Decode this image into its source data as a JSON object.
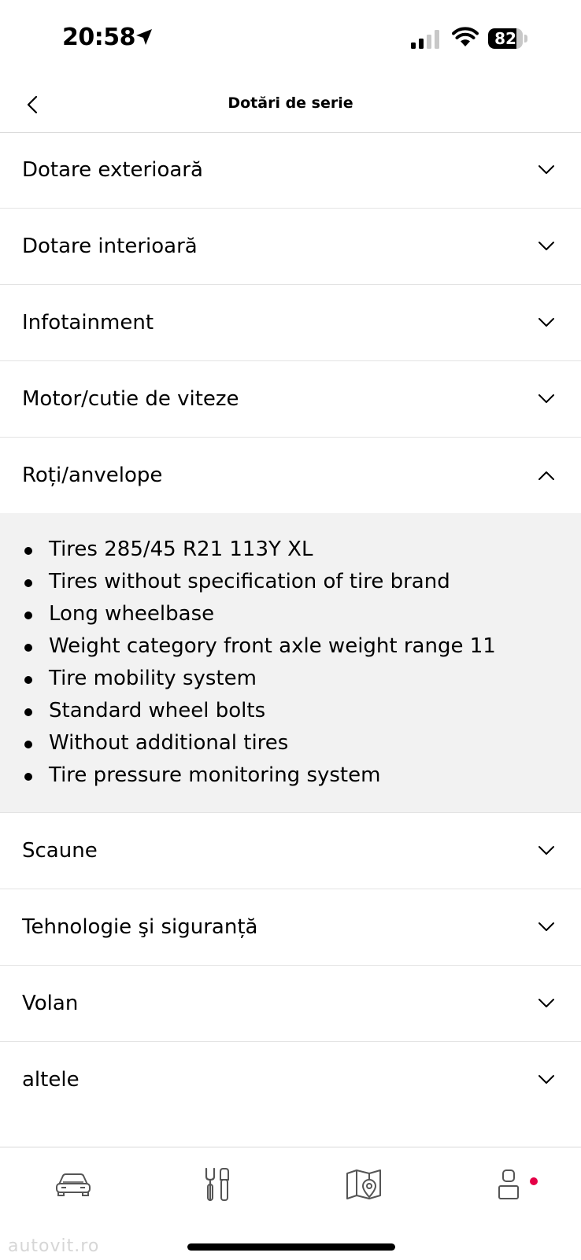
{
  "status_bar": {
    "time": "20:58",
    "battery_level": "82",
    "battery_fraction": 0.82
  },
  "header": {
    "title": "Dotări de serie",
    "back_icon": "chevron-left-icon"
  },
  "accordion": {
    "sections": [
      {
        "label": "Dotare exterioară",
        "expanded": false
      },
      {
        "label": "Dotare interioară",
        "expanded": false
      },
      {
        "label": "Infotainment",
        "expanded": false
      },
      {
        "label": "Motor/cutie de viteze",
        "expanded": false
      },
      {
        "label": "Roți/anvelope",
        "expanded": true,
        "items": [
          "Tires 285/45 R21 113Y XL",
          "Tires without specification of tire brand",
          "Long wheelbase",
          "Weight category front axle weight range 11",
          "Tire mobility system",
          "Standard wheel bolts",
          "Without additional tires",
          "Tire pressure monitoring system"
        ]
      },
      {
        "label": "Scaune",
        "expanded": false
      },
      {
        "label": "Tehnologie şi siguranță",
        "expanded": false
      },
      {
        "label": "Volan",
        "expanded": false
      },
      {
        "label": "altele",
        "expanded": false
      }
    ]
  },
  "tab_bar": {
    "tabs": [
      {
        "icon": "car-icon"
      },
      {
        "icon": "tools-icon"
      },
      {
        "icon": "map-icon"
      },
      {
        "icon": "profile-icon",
        "notification": true
      }
    ],
    "notification_color": "#e40046"
  },
  "watermark": "autovit.ro"
}
